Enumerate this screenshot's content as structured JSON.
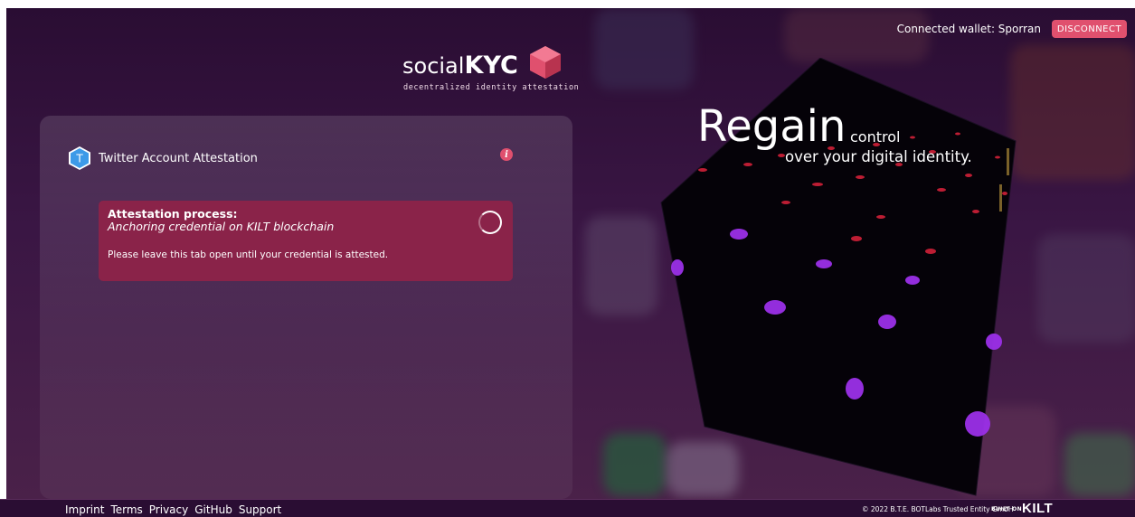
{
  "header": {
    "connected_wallet": "Connected wallet: Sporran",
    "disconnect_label": "DISCONNECT"
  },
  "logo": {
    "brand_light": "social",
    "brand_bold": "KYC",
    "tagline": "decentralized identity attestation"
  },
  "card": {
    "title": "Twitter Account Attestation",
    "service_icon_letter": "T",
    "info_icon_glyph": "i",
    "process": {
      "heading": "Attestation process:",
      "status": "Anchoring credential on KILT blockchain",
      "note": "Please leave this tab open until your credential is attested."
    }
  },
  "hero": {
    "big": "Regain",
    "small": "control",
    "line2": "over your digital identity."
  },
  "footer": {
    "links": [
      "Imprint",
      "Terms",
      "Privacy",
      "GitHub",
      "Support"
    ],
    "copyright": "© 2022 B.T.E. BOTLabs Trusted Entity GmbH",
    "built_on": "BUILT ON",
    "kilt": "KILT"
  },
  "colors": {
    "accent": "#e0506e",
    "process_bg": "#8a2349",
    "background": "#2a0d33"
  }
}
